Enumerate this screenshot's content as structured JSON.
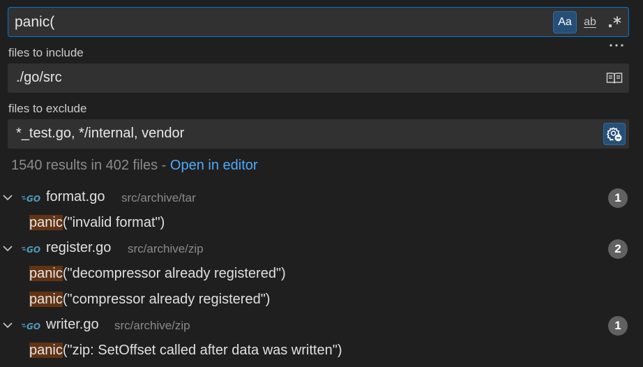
{
  "search": {
    "query": "panic(",
    "match_case_label": "Aa",
    "whole_word_label": "ab",
    "regex_label": ".*"
  },
  "more_label": "...",
  "include": {
    "label": "files to include",
    "value": "./go/src"
  },
  "exclude": {
    "label": "files to exclude",
    "value": "*_test.go, */internal, vendor"
  },
  "summary": {
    "text": "1540 results in 402 files - ",
    "link": "Open in editor"
  },
  "results": [
    {
      "file": "format.go",
      "path": "src/archive/tar",
      "count": "1",
      "matches": [
        {
          "highlight": "panic",
          "rest": "(\"invalid format\")"
        }
      ]
    },
    {
      "file": "register.go",
      "path": "src/archive/zip",
      "count": "2",
      "matches": [
        {
          "highlight": "panic",
          "rest": "(\"decompressor already registered\")"
        },
        {
          "highlight": "panic",
          "rest": "(\"compressor already registered\")"
        }
      ]
    },
    {
      "file": "writer.go",
      "path": "src/archive/zip",
      "count": "1",
      "matches": [
        {
          "highlight": "panic",
          "rest": "(\"zip: SetOffset called after data was written\")"
        }
      ]
    }
  ],
  "colors": {
    "accent": "#0078d4",
    "highlight": "#623315",
    "link": "#4daafc",
    "go_icon": "#519aba"
  }
}
